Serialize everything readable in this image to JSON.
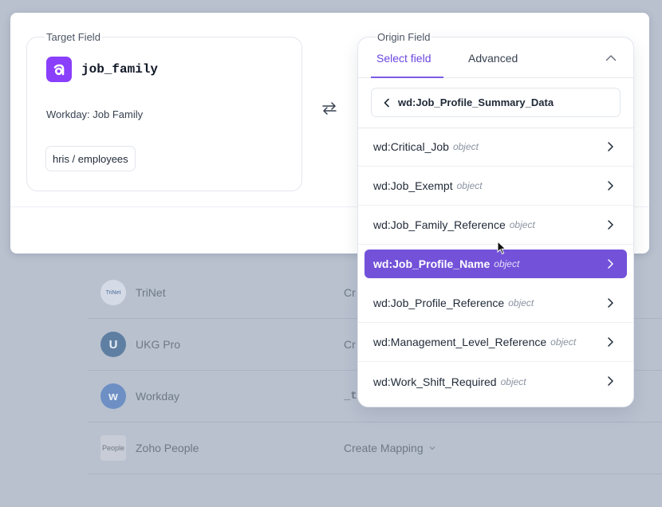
{
  "background_list": {
    "rows": [
      {
        "name": "TriNet",
        "action": "Cr",
        "logo": "TriNet",
        "logo_color": "#cdd6e5"
      },
      {
        "name": "UKG Pro",
        "action": "Cr",
        "logo": "U",
        "logo_color": "#5f7fa2"
      },
      {
        "name": "Workday",
        "action": "_t",
        "logo": "w",
        "logo_color": "#6d8fc4"
      },
      {
        "name": "Zoho People",
        "action": "Create Mapping",
        "logo": "People",
        "logo_color": "#c7ccd6"
      }
    ]
  },
  "target_field": {
    "legend": "Target Field",
    "icon": "a",
    "icon_color": "#8a3ffc",
    "code": "job_family",
    "description": "Workday: Job Family",
    "path": "hris / employees"
  },
  "origin_field": {
    "legend": "Origin Field",
    "tabs": [
      "Select field",
      "Advanced"
    ],
    "breadcrumb": "wd:Job_Profile_Summary_Data",
    "accent": "#7352d9",
    "options": [
      {
        "name": "wd:Critical_Job",
        "type": "object"
      },
      {
        "name": "wd:Job_Exempt",
        "type": "object"
      },
      {
        "name": "wd:Job_Family_Reference",
        "type": "object"
      },
      {
        "name": "wd:Job_Profile_Name",
        "type": "object",
        "selected": true
      },
      {
        "name": "wd:Job_Profile_Reference",
        "type": "object"
      },
      {
        "name": "wd:Management_Level_Reference",
        "type": "object"
      },
      {
        "name": "wd:Work_Shift_Required",
        "type": "object"
      }
    ]
  }
}
